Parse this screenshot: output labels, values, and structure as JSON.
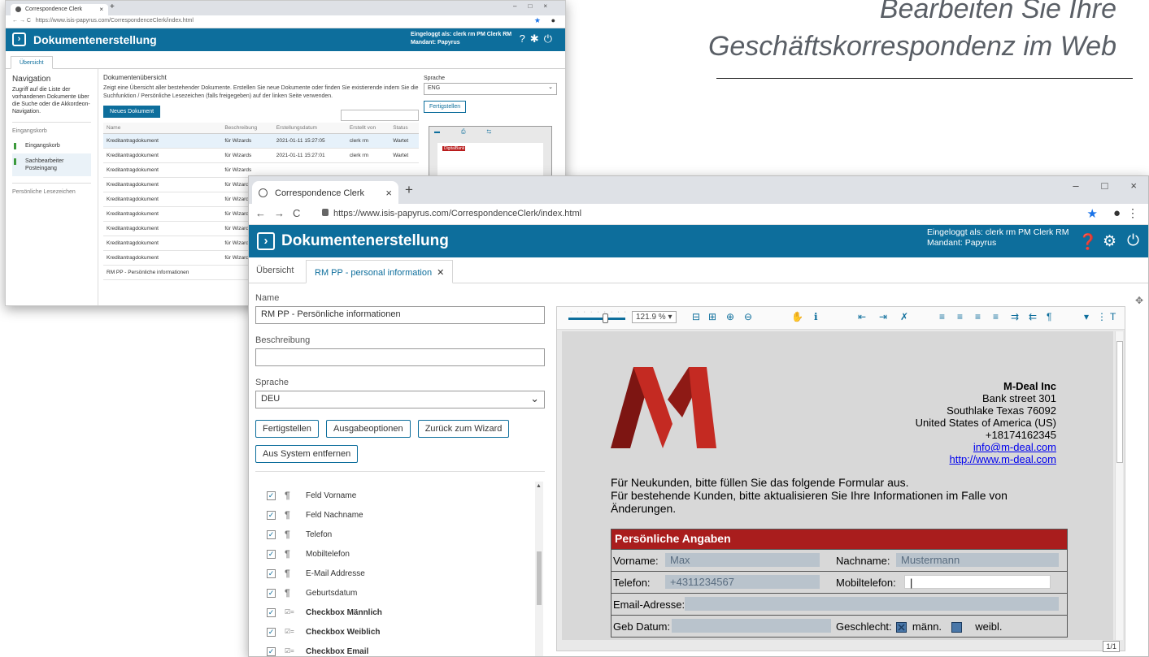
{
  "headline": {
    "line1": "Bearbeiten Sie Ihre",
    "line2": "Geschäftskorrespondenz im Web"
  },
  "back_window": {
    "tab_title": "Correspondence Clerk",
    "url": "https://www.isis-papyrus.com/CorrespondenceClerk/index.html",
    "app_title": "Dokumentenerstellung",
    "login_line1": "Eingeloggt als: clerk rm PM Clerk RM",
    "login_line2": "Mandant: Papyrus",
    "tab": "Übersicht",
    "nav": {
      "title": "Navigation",
      "desc": "Zugriff auf die Liste der vorhandenen Dokumente über die Suche oder die Akkordeon-Navigation.",
      "section": "Eingangskorb",
      "items": [
        "Eingangskorb",
        "Sachbearbeiter Posteingang"
      ],
      "bookmarks": "Persönliche Lesezeichen"
    },
    "main": {
      "title": "Dokumentenübersicht",
      "desc": "Zeigt eine Übersicht aller bestehender Dokumente. Erstellen Sie neue Dokumente oder finden Sie existierende indem Sie die Suchfunktion / Persönliche Lesezeichen (falls freigegeben) auf der linken Seite verwenden.",
      "new_button": "Neues Dokument",
      "columns": [
        "Name",
        "Beschreibung",
        "Erstellungsdatum",
        "Erstellt von",
        "Status"
      ],
      "rows": [
        [
          "Kreditantragdokument",
          "für Wizards",
          "2021-01-11  15:27:05",
          "clerk rm",
          "Wartet"
        ],
        [
          "Kreditantragdokument",
          "für Wizards",
          "2021-01-11  15:27:01",
          "clerk rm",
          "Wartet"
        ],
        [
          "Kreditantragdokument",
          "für Wizards",
          "",
          "",
          ""
        ],
        [
          "Kreditantragdokument",
          "für Wizards",
          "",
          "",
          ""
        ],
        [
          "Kreditantragdokument",
          "für Wizards",
          "",
          "",
          ""
        ],
        [
          "Kreditantragdokument",
          "für Wizards",
          "",
          "",
          ""
        ],
        [
          "Kreditantragdokument",
          "für Wizards",
          "",
          "",
          ""
        ],
        [
          "Kreditantragdokument",
          "für Wizards",
          "",
          "",
          ""
        ],
        [
          "Kreditantragdokument",
          "für Wizards",
          "",
          "",
          ""
        ],
        [
          "RM PP - Persönliche informationen",
          "",
          "",
          "",
          ""
        ]
      ]
    },
    "right": {
      "lang_label": "Sprache",
      "lang_value": "ENG",
      "finish_button": "Fertigstellen",
      "thumb_logo": "DigitalBank"
    }
  },
  "front_window": {
    "tab_title": "Correspondence Clerk",
    "url": "https://www.isis-papyrus.com/CorrespondenceClerk/index.html",
    "app_title": "Dokumentenerstellung",
    "login_line1": "Eingeloggt als: clerk rm PM Clerk RM",
    "login_line2": "Mandant: Papyrus",
    "tabs": {
      "overview": "Übersicht",
      "active": "RM PP - personal information"
    },
    "form": {
      "name_label": "Name",
      "name_value": "RM  PP - Persönliche informationen",
      "desc_label": "Beschreibung",
      "desc_value": "",
      "lang_label": "Sprache",
      "lang_value": "DEU",
      "btn_finish": "Fertigstellen",
      "btn_output": "Ausgabeoptionen",
      "btn_back": "Zurück zum Wizard",
      "btn_remove": "Aus System entfernen"
    },
    "fields": [
      {
        "label": "Feld Vorname",
        "kind": "para",
        "bold": false
      },
      {
        "label": "Feld Nachname",
        "kind": "para",
        "bold": false
      },
      {
        "label": "Telefon",
        "kind": "para",
        "bold": false
      },
      {
        "label": "Mobiltelefon",
        "kind": "para",
        "bold": false
      },
      {
        "label": "E-Mail Addresse",
        "kind": "para",
        "bold": false
      },
      {
        "label": "Geburtsdatum",
        "kind": "para",
        "bold": false
      },
      {
        "label": "Checkbox Männlich",
        "kind": "check",
        "bold": true
      },
      {
        "label": "Checkbox Weiblich",
        "kind": "check",
        "bold": true
      },
      {
        "label": "Checkbox Email",
        "kind": "check",
        "bold": true
      }
    ],
    "viewer": {
      "zoom": "121.9 %",
      "page_indicator": "1/1",
      "company": {
        "name": "M-Deal Inc",
        "street": "Bank street 301",
        "city": "Southlake Texas 76092",
        "country": "United States of America (US)",
        "phone": "+18174162345",
        "email": "info@m-deal.com",
        "web": "http://www.m-deal.com"
      },
      "intro_line1": "Für Neukunden, bitte füllen Sie das folgende Formular aus.",
      "intro_line2": "Für bestehende Kunden, bitte aktualisieren Sie Ihre Informationen im Falle von Änderungen.",
      "table": {
        "heading": "Persönliche Angaben",
        "vorname_label": "Vorname:",
        "vorname_value": "Max",
        "nachname_label": "Nachname:",
        "nachname_value": "Mustermann",
        "telefon_label": "Telefon:",
        "telefon_value": "+4311234567",
        "mobil_label": "Mobiltelefon:",
        "email_label": "Email-Adresse:",
        "geb_label": "Geb Datum:",
        "geschlecht_label": "Geschlecht:",
        "maenn": "männ.",
        "weibl": "weibl."
      }
    }
  },
  "colors": {
    "brand_blue": "#0d6e9c",
    "table_red": "#a91d1d",
    "logo_red": "#b3221d"
  }
}
